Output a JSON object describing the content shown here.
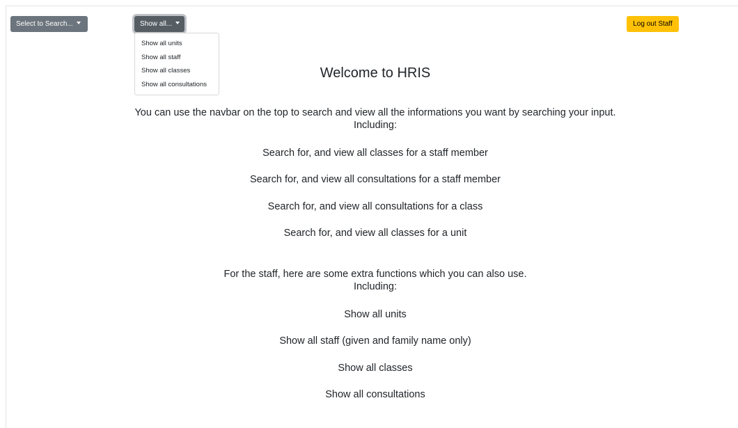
{
  "navbar": {
    "search_button": "Select to Search...",
    "show_all_button": "Show all...",
    "logout_button": "Log out Staff"
  },
  "dropdown": {
    "items": [
      {
        "label": "Show all units"
      },
      {
        "label": "Show all staff"
      },
      {
        "label": "Show all classes"
      },
      {
        "label": "Show all consultations"
      }
    ]
  },
  "main": {
    "title": "Welcome to HRIS",
    "intro_line1": "You can use the navbar on the top to search and view all the informations you want by searching your input.",
    "intro_line2": "Including:",
    "search_features": [
      "Search for, and view all classes for a staff member",
      "Search for, and view all consultations for a staff member",
      "Search for, and view all consultations for a class",
      "Search for, and view all classes for a unit"
    ],
    "staff_line1": "For the staff, here are some extra functions which you can also use.",
    "staff_line2": "Including:",
    "staff_features": [
      "Show all units",
      "Show all staff (given and family name only)",
      "Show all classes",
      "Show all consultations"
    ]
  },
  "colors": {
    "secondary": "#6c757d",
    "warning": "#ffc107",
    "text": "#212529"
  }
}
